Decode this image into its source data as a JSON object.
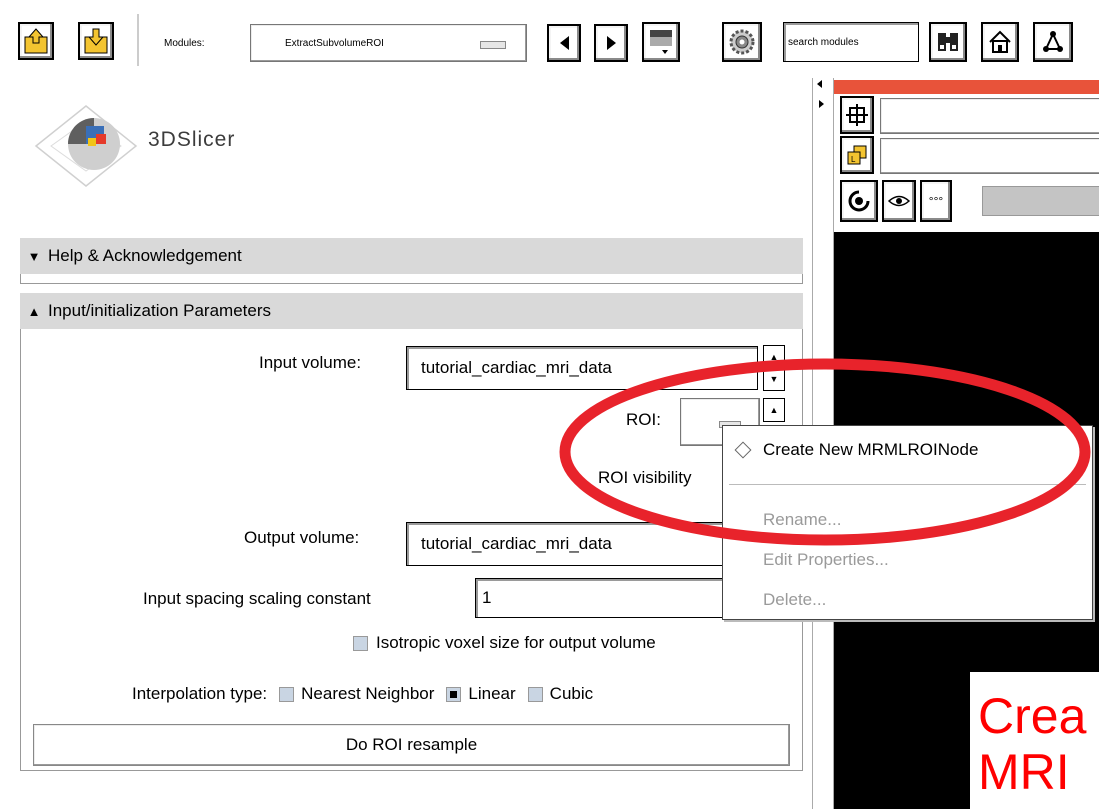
{
  "toolbar": {
    "modules_label": "Modules:",
    "module_selected": "ExtractSubvolumeROI",
    "search_placeholder": "search modules"
  },
  "logo": {
    "text": "3DSlicer"
  },
  "panels": {
    "help_title": "Help & Acknowledgement",
    "params_title": "Input/initialization Parameters"
  },
  "params": {
    "input_volume_label": "Input volume:",
    "input_volume_value": "tutorial_cardiac_mri_data",
    "roi_label": "ROI:",
    "roi_visibility_label": "ROI visibility",
    "output_volume_label": "Output volume:",
    "output_volume_value": "tutorial_cardiac_mri_data",
    "spacing_label": "Input spacing scaling constant",
    "spacing_value": "1",
    "isotropic_label": "Isotropic voxel size for output volume",
    "interp_label": "Interpolation type:",
    "interp_options": [
      "Nearest Neighbor",
      "Linear",
      "Cubic"
    ],
    "interp_selected": "Linear",
    "resample_button": "Do ROI resample"
  },
  "context_menu": {
    "create": "Create New MRMLROINode",
    "rename": "Rename...",
    "edit": "Edit Properties...",
    "delete": "Delete..."
  },
  "annotation": {
    "line1": "Crea",
    "line2": "MRI",
    "color": "#ff0000"
  },
  "colors": {
    "viewer_top_bar": "#e8533a",
    "viewer_background": "#000000",
    "highlight_ellipse": "#e8232b"
  }
}
